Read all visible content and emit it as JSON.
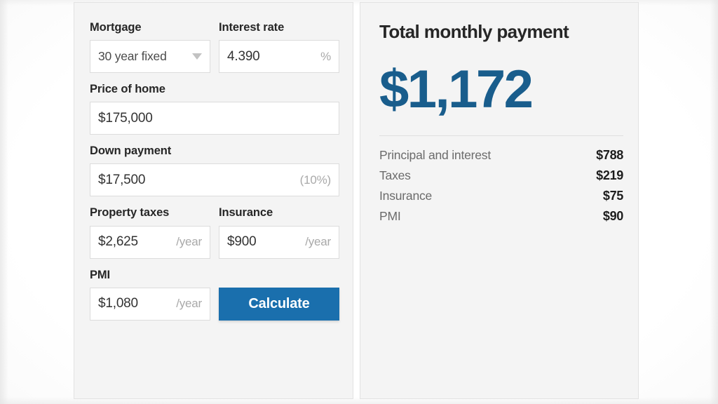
{
  "calculator": {
    "fields": {
      "mortgage": {
        "label": "Mortgage",
        "value": "30 year fixed",
        "caret_icon": "chevron-down-icon"
      },
      "interest_rate": {
        "label": "Interest rate",
        "value": "4.390",
        "suffix": "%"
      },
      "price_of_home": {
        "label": "Price of home",
        "value": "$175,000",
        "suffix": ""
      },
      "down_payment": {
        "label": "Down payment",
        "value": "$17,500",
        "suffix": "(10%)"
      },
      "property_taxes": {
        "label": "Property taxes",
        "value": "$2,625",
        "suffix": "/year"
      },
      "insurance": {
        "label": "Insurance",
        "value": "$900",
        "suffix": "/year"
      },
      "pmi": {
        "label": "PMI",
        "value": "$1,080",
        "suffix": "/year"
      }
    },
    "calculate_button": {
      "label": "Calculate",
      "color": "#1a6fad"
    }
  },
  "summary": {
    "title": "Total monthly payment",
    "total": "$1,172",
    "total_color": "#195d8c",
    "breakdown": [
      {
        "label": "Principal and interest",
        "value": "$788"
      },
      {
        "label": "Taxes",
        "value": "$219"
      },
      {
        "label": "Insurance",
        "value": "$75"
      },
      {
        "label": "PMI",
        "value": "$90"
      }
    ]
  }
}
